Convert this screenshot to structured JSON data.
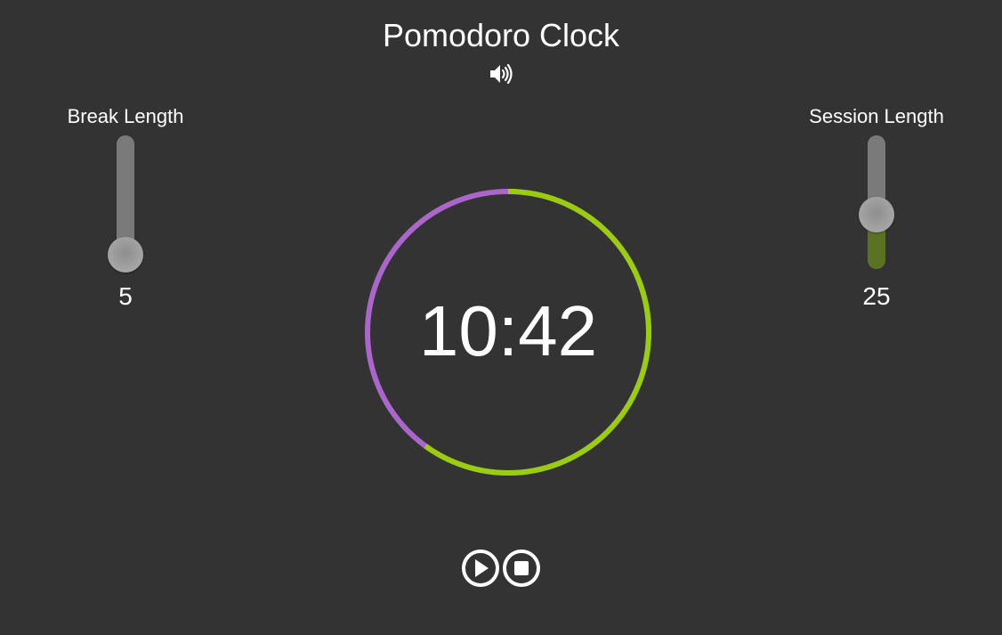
{
  "app": {
    "title": "Pomodoro Clock"
  },
  "sound": {
    "icon": "speaker-volume-icon"
  },
  "break": {
    "label": "Break Length",
    "value": "5",
    "slider_fraction": 0.12
  },
  "session": {
    "label": "Session Length",
    "value": "25",
    "slider_fraction": 0.42
  },
  "timer": {
    "time": "10:42",
    "progress_fraction": 0.6,
    "colors": {
      "elapsed": "#9acd0e",
      "remaining": "#ab66cc"
    }
  },
  "controls": {
    "play_icon": "play-icon",
    "stop_icon": "stop-icon"
  },
  "colors": {
    "background": "#333333",
    "text": "#ffffff",
    "slider_track": "#7a7a7a",
    "slider_fill": "#5a7222"
  }
}
